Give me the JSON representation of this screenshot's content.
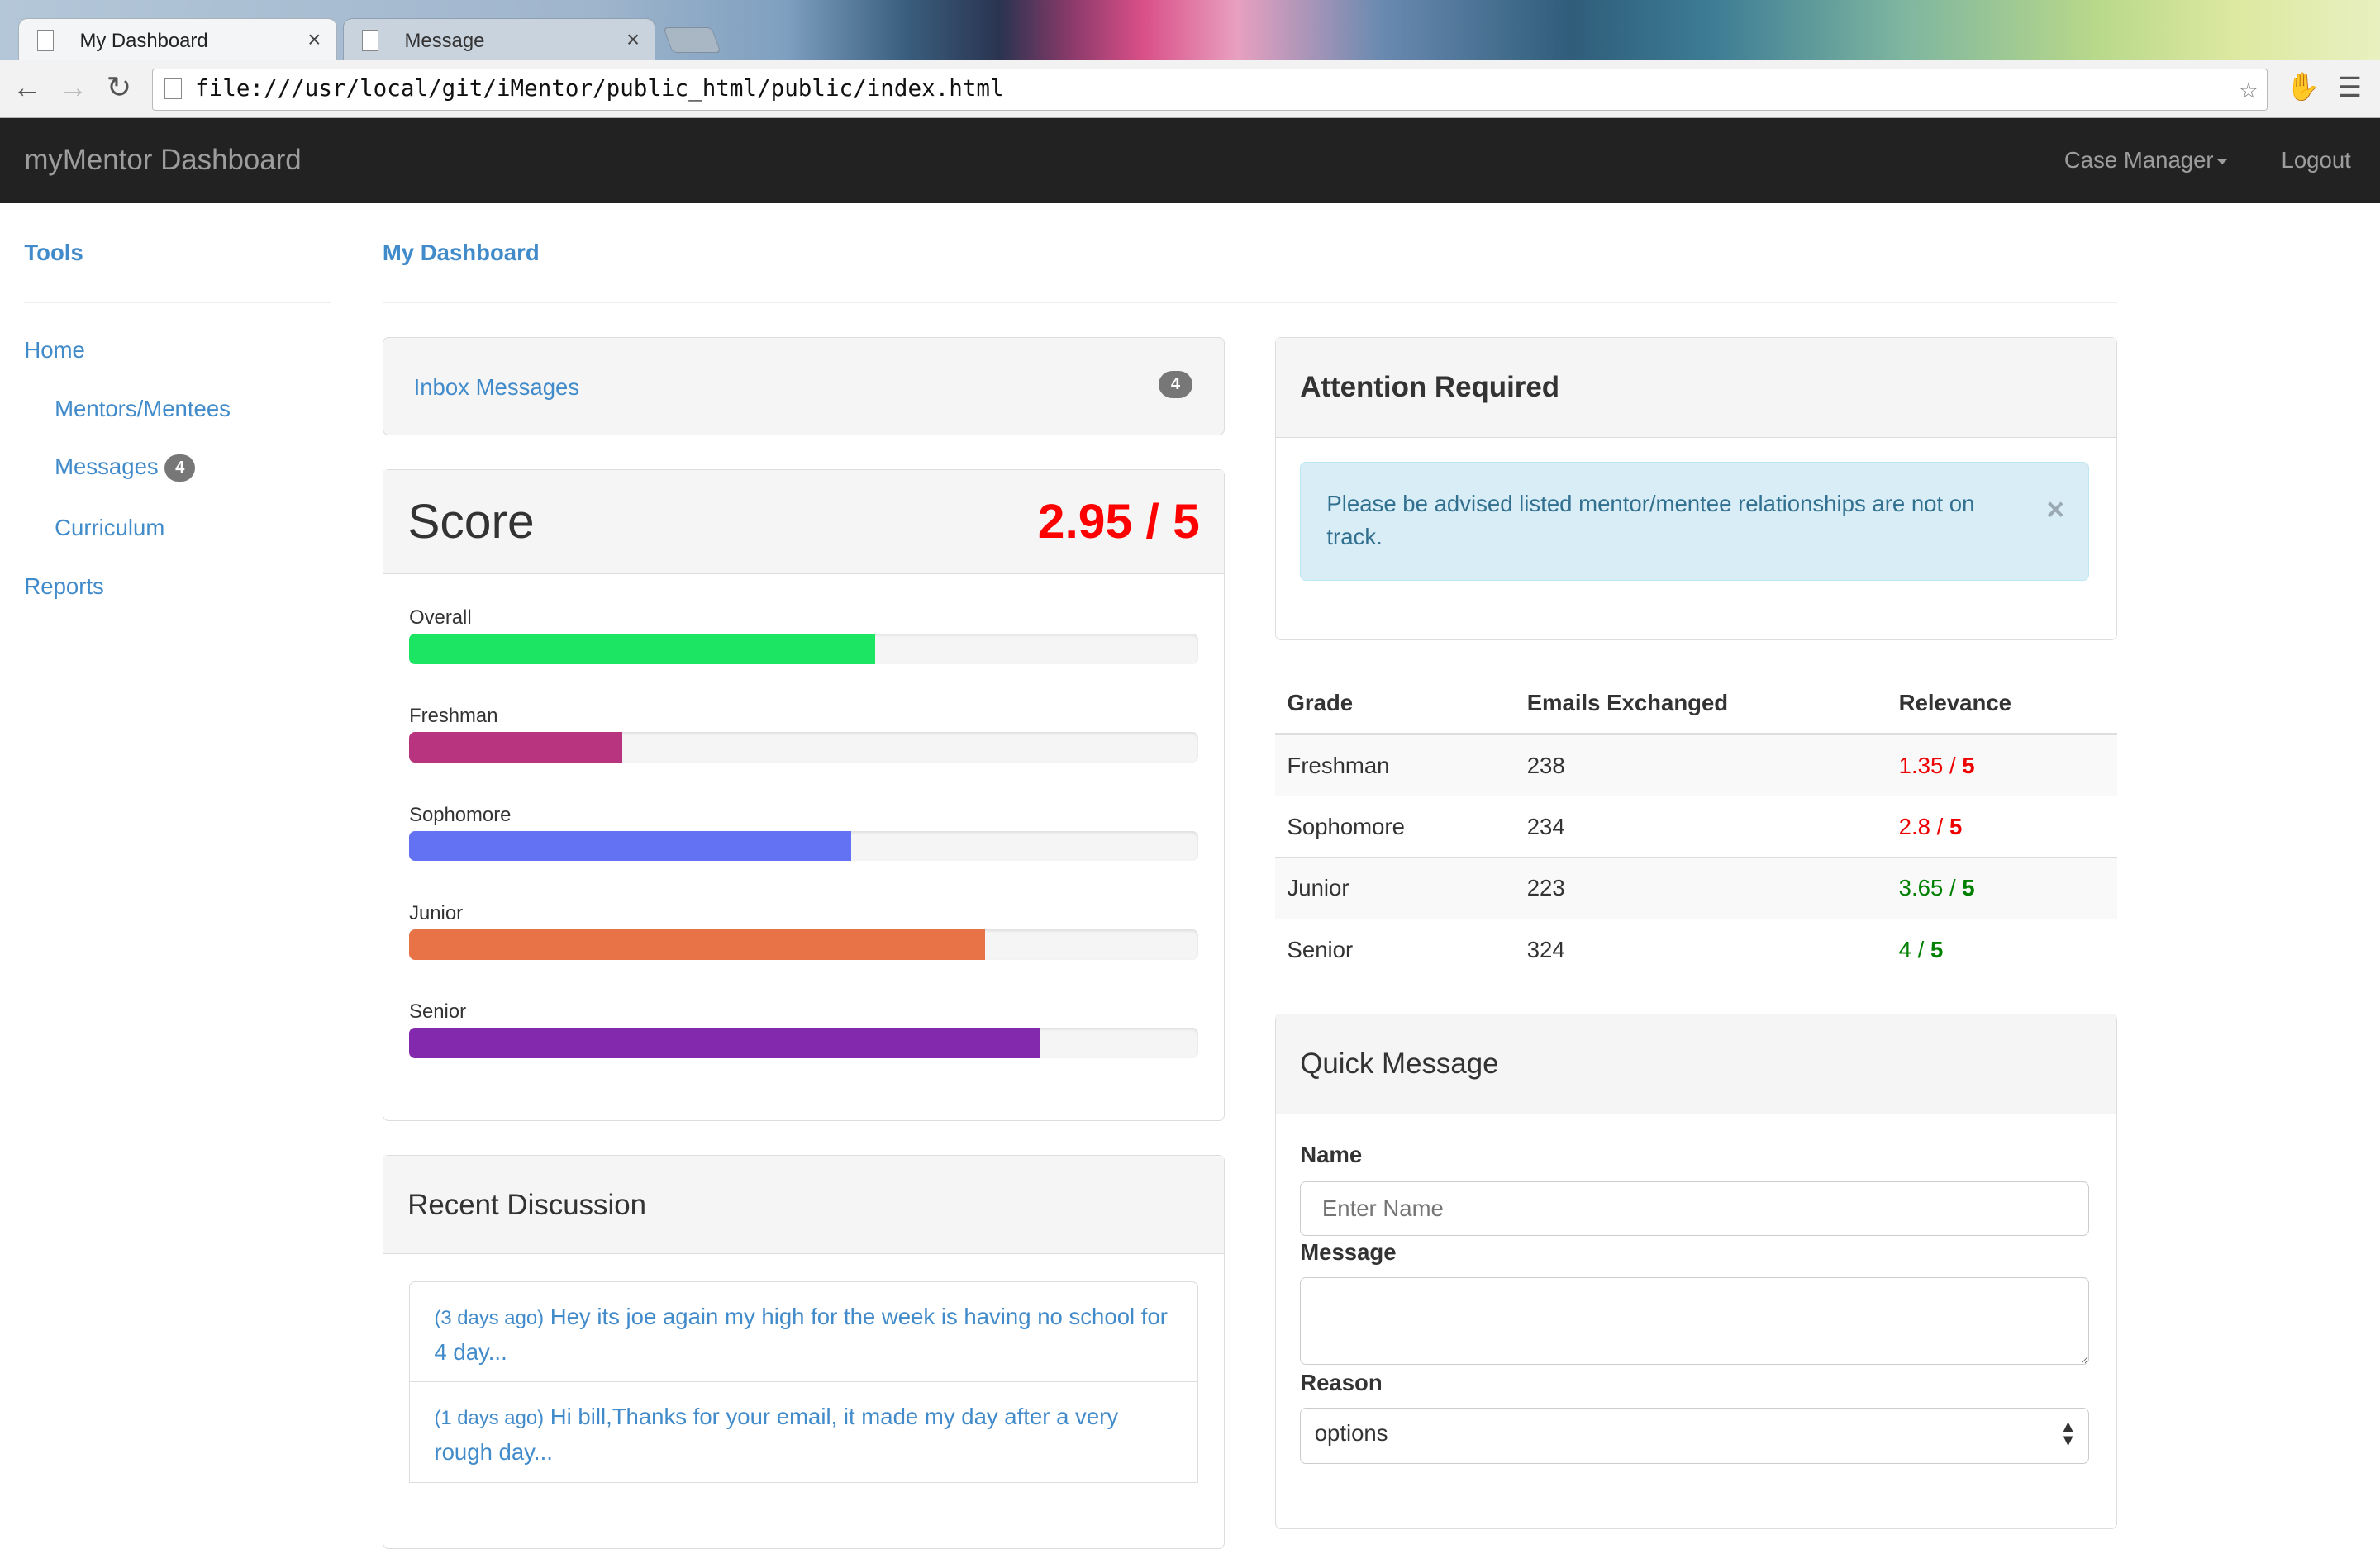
{
  "browser": {
    "tabs": [
      {
        "label": "My Dashboard",
        "active": true
      },
      {
        "label": "Message",
        "active": false
      }
    ],
    "url": "file:///usr/local/git/iMentor/public_html/public/index.html",
    "close_glyph": "×"
  },
  "navbar": {
    "brand": "myMentor Dashboard",
    "menu": "Case Manager",
    "logout": "Logout"
  },
  "sidebar": {
    "tools": "Tools",
    "home": "Home",
    "items": [
      {
        "label": "Mentors/Mentees"
      },
      {
        "label": "Messages",
        "badge": "4"
      },
      {
        "label": "Curriculum"
      }
    ],
    "reports": "Reports"
  },
  "page": {
    "title": "My Dashboard"
  },
  "inbox": {
    "label": "Inbox Messages",
    "count": "4"
  },
  "score": {
    "title": "Score",
    "value": "2.95 / 5",
    "value_color": "#ff0000",
    "bars": [
      {
        "label": "Overall",
        "fraction": 0.59,
        "color": "#1de564"
      },
      {
        "label": "Freshman",
        "fraction": 0.27,
        "color": "#b9347f"
      },
      {
        "label": "Sophomore",
        "fraction": 0.56,
        "color": "#6272f2"
      },
      {
        "label": "Junior",
        "fraction": 0.73,
        "color": "#e77346"
      },
      {
        "label": "Senior",
        "fraction": 0.8,
        "color": "#8329ae"
      }
    ]
  },
  "attention": {
    "title": "Attention Required",
    "alert": "Please be advised listed mentor/mentee relationships are not on track.",
    "close": "×"
  },
  "grades_table": {
    "headers": [
      "Grade",
      "Emails Exchanged",
      "Relevance"
    ],
    "rows": [
      {
        "grade": "Freshman",
        "emails": "238",
        "score": "1.35",
        "max": "5",
        "status": "red"
      },
      {
        "grade": "Sophomore",
        "emails": "234",
        "score": "2.8",
        "max": "5",
        "status": "red"
      },
      {
        "grade": "Junior",
        "emails": "223",
        "score": "3.65",
        "max": "5",
        "status": "green"
      },
      {
        "grade": "Senior",
        "emails": "324",
        "score": "4",
        "max": "5",
        "status": "green"
      }
    ]
  },
  "discussion": {
    "title": "Recent Discussion",
    "items": [
      {
        "ago": "(3 days ago)",
        "text": "Hey its joe again my high for the week is having no school for 4 day..."
      },
      {
        "ago": "(1 days ago)",
        "text": "Hi bill,Thanks for your email, it made my day after a very rough day..."
      }
    ]
  },
  "quick_message": {
    "title": "Quick Message",
    "name_label": "Name",
    "name_placeholder": "Enter Name",
    "message_label": "Message",
    "reason_label": "Reason",
    "reason_value": "options"
  }
}
